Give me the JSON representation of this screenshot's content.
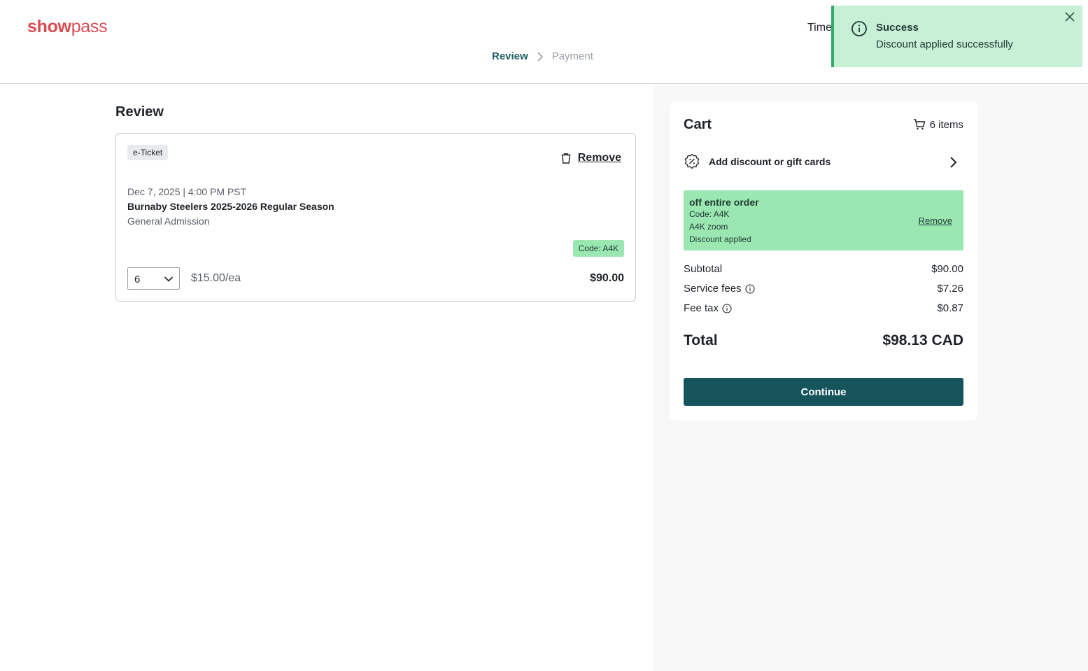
{
  "brand": {
    "logo_bold": "show",
    "logo_light": "pass",
    "color": "#d94b52"
  },
  "steps": {
    "review": "Review",
    "payment": "Payment"
  },
  "timer_label": "Time",
  "toast": {
    "title": "Success",
    "message": "Discount applied successfully",
    "bg": "#c7f0d6",
    "accent": "#35a86a"
  },
  "review": {
    "title": "Review",
    "ticket": {
      "badge": "e-Ticket",
      "remove_label": "Remove",
      "date": "Dec 7, 2025 | 4:00 PM PST",
      "event_name": "Burnaby Steelers 2025-2026 Regular Season",
      "admission": "General Admission",
      "code_badge": "Code: A4K",
      "quantity": "6",
      "unit_price": "$15.00/ea",
      "line_total": "$90.00"
    }
  },
  "cart": {
    "title": "Cart",
    "item_count": "6 items",
    "discount_link": "Add discount or gift cards",
    "applied_discount": {
      "title": "off entire order",
      "code": "Code: A4K",
      "name": "A4K zoom",
      "status": "Discount applied",
      "remove_label": "Remove"
    },
    "subtotal_label": "Subtotal",
    "subtotal": "$90.00",
    "service_fees_label": "Service fees",
    "service_fees": "$7.26",
    "fee_tax_label": "Fee tax",
    "fee_tax": "$0.87",
    "total_label": "Total",
    "total": "$98.13 CAD",
    "continue_label": "Continue",
    "button_color": "#16545c"
  }
}
